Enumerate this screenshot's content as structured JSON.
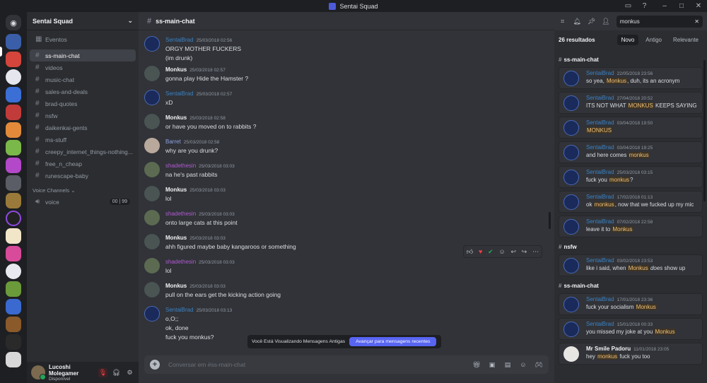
{
  "window": {
    "title": "Sentai Squad"
  },
  "guild": {
    "name": "Sentai Squad"
  },
  "sidebar": {
    "events": "Eventos",
    "channels": [
      "ss-main-chat",
      "videos",
      "music-chat",
      "sales-and-deals",
      "brad-quotes",
      "nsfw",
      "daikenkai-gents",
      "ms-stuff",
      "creepy_internet_things-nothing...",
      "free_n_cheap",
      "runescape-baby"
    ],
    "voice_header": "Voice Channels",
    "voice_channel": "voice",
    "voice_badges": [
      "00",
      "99"
    ]
  },
  "user": {
    "name": "Lucoshi Molegamer",
    "status": "Disponível"
  },
  "chat": {
    "channel": "ss-main-chat",
    "messages": [
      {
        "author": "SentaiBrad",
        "time": "25/03/2018 02:56",
        "lines": [
          "ORGY MOTHER FUCKERS",
          "(im drunk)"
        ]
      },
      {
        "author": "Monkus",
        "time": "25/03/2018 02:57",
        "lines": [
          "gonna play Hide the Hamster ?"
        ]
      },
      {
        "author": "SentaiBrad",
        "time": "25/03/2018 02:57",
        "lines": [
          "xD"
        ]
      },
      {
        "author": "Monkus",
        "time": "25/03/2018 02:58",
        "lines": [
          "or have you moved on to rabbits ?"
        ]
      },
      {
        "author": "Barret",
        "time": "25/03/2018 02:58",
        "lines": [
          "why are you drunk?"
        ]
      },
      {
        "author": "shadethesin",
        "time": "25/03/2018 03:03",
        "lines": [
          "na he's past rabbits"
        ]
      },
      {
        "author": "Monkus",
        "time": "25/03/2018 03:03",
        "lines": [
          "lol"
        ]
      },
      {
        "author": "shadethesin",
        "time": "25/03/2018 03:03",
        "lines": [
          "onto large cats at this point"
        ]
      },
      {
        "author": "Monkus",
        "time": "25/03/2018 03:03",
        "lines": [
          "ahh figured maybe baby kangaroos or something"
        ]
      },
      {
        "author": "shadethesin",
        "time": "25/03/2018 03:03",
        "lines": [
          "lol"
        ]
      },
      {
        "author": "Monkus",
        "time": "25/03/2018 03:03",
        "lines": [
          "pull on the ears get the kicking action going"
        ]
      },
      {
        "author": "SentaiBrad",
        "time": "25/03/2018 03:13",
        "lines": [
          "o,O;;",
          "ok, done",
          "fuck you monkus?"
        ]
      }
    ],
    "old_notice": "Você Está Visualizando Mensagens Antigas",
    "jump_label": "Avançar para mensagens recentes",
    "composer_placeholder": "Conversar em #ss-main-chat"
  },
  "search": {
    "query": "monkus",
    "count": "26 resultados",
    "sort": [
      "Novo",
      "Antigo",
      "Relevante"
    ],
    "groups": [
      {
        "channel": "ss-main-chat",
        "results": [
          {
            "author": "SentaiBrad",
            "time": "22/05/2018 23:56",
            "pre": "so yea, ",
            "hit": "Monkus",
            "post": ", duh, its an acronym"
          },
          {
            "author": "SentaiBrad",
            "time": "27/04/2018 20:52",
            "pre": "ITS NOT WHAT ",
            "hit": "MONKUS",
            "post": " KEEPS SAYING"
          },
          {
            "author": "SentaiBrad",
            "time": "03/04/2018 19:50",
            "pre": "",
            "hit": "MONKUS",
            "post": ""
          },
          {
            "author": "SentaiBrad",
            "time": "03/04/2018 19:25",
            "pre": "and here comes ",
            "hit": "monkus",
            "post": ""
          },
          {
            "author": "SentaiBrad",
            "time": "25/03/2018 03:15",
            "pre": "fuck you ",
            "hit": "monkus",
            "post": "?"
          },
          {
            "author": "SentaiBrad",
            "time": "17/02/2018 01:13",
            "pre": "ok ",
            "hit": "monkus",
            "post": ", now that we fucked up my mic"
          },
          {
            "author": "SentaiBrad",
            "time": "07/02/2018 22:58",
            "pre": "leave it to ",
            "hit": "Monkus",
            "post": ""
          }
        ]
      },
      {
        "channel": "nsfw",
        "results": [
          {
            "author": "SentaiBrad",
            "time": "03/02/2018 23:53",
            "pre": "like i said, when ",
            "hit": "Monkus",
            "italic": "does",
            "post": " show up"
          }
        ]
      },
      {
        "channel": "ss-main-chat",
        "results": [
          {
            "author": "SentaiBrad",
            "time": "17/01/2018 23:36",
            "pre": "fuck your socialism ",
            "hit": "Monkus",
            "post": ""
          },
          {
            "author": "SentaiBrad",
            "time": "15/01/2018 00:33",
            "pre": "you missed my joke at you ",
            "hit": "Monkus",
            "post": ""
          },
          {
            "author": "Mr Smile Padoru",
            "time": "11/01/2018 23:05",
            "pre": "hey ",
            "hit": "monkus",
            "post": " fuck you too"
          }
        ]
      }
    ]
  },
  "colors": {
    "accent": "#5865f2",
    "sentai": "#3b82c4",
    "shade": "#b05ad1",
    "barret": "#8ea1e1",
    "highlight": "#f0c078"
  }
}
